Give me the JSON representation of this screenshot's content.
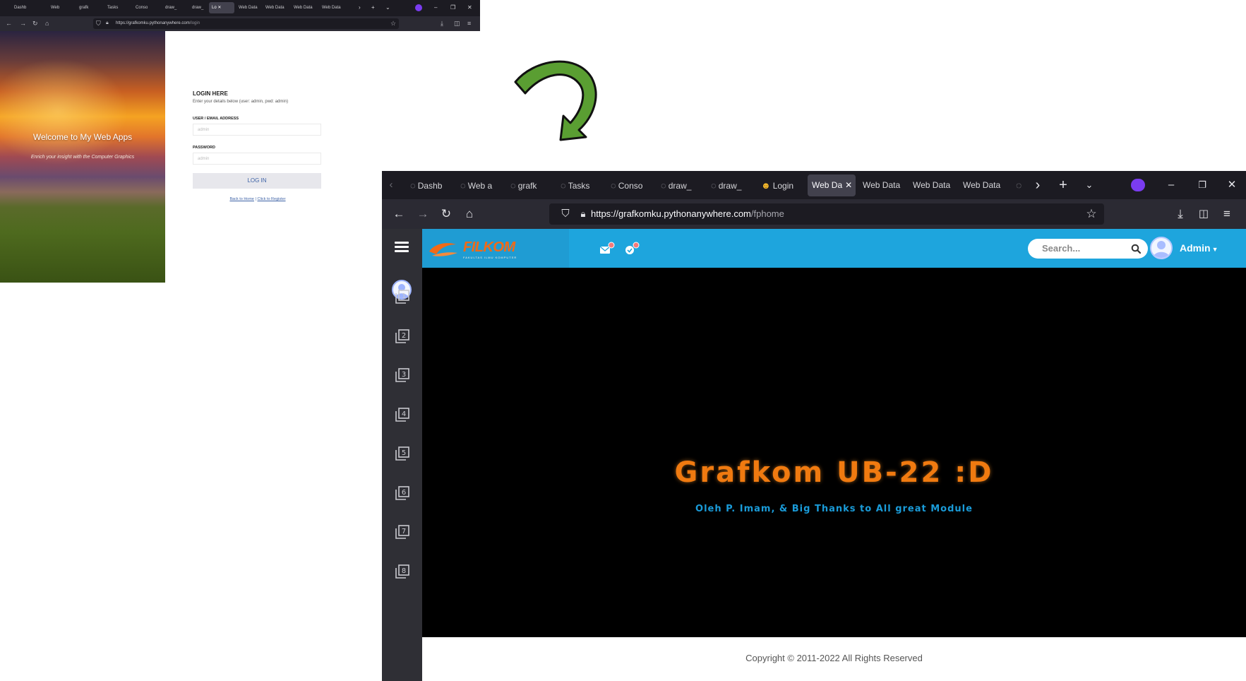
{
  "small_browser": {
    "tabs": [
      "Dashb",
      "Web",
      "grafk",
      "Tasks",
      "Conso",
      "draw_",
      "draw_",
      "Lo",
      "Web Data",
      "Web Data",
      "Web Data",
      "Web Data"
    ],
    "active_tab": "Lo",
    "url_host": "https://grafkomku.pythonanywhere.com",
    "url_path": "/login",
    "hero": {
      "title": "Welcome to My Web Apps",
      "subtitle": "Enrich your insight with the Computer Graphics"
    },
    "login": {
      "heading": "LOGIN HERE",
      "description": "Enter your details below (user: admin, pwd: admin)",
      "user_label": "USER / EMAIL ADDRESS",
      "user_placeholder": "admin",
      "password_label": "PASSWORD",
      "password_placeholder": "admin",
      "button": "LOG IN",
      "link_home": "Back to Home",
      "separator": "|",
      "link_register": "Click to Register"
    }
  },
  "big_browser": {
    "tabs": [
      "Dashb",
      "Web a",
      "grafk",
      "Tasks",
      "Conso",
      "draw_",
      "draw_",
      "Login",
      "Web Da",
      "Web Data",
      "Web Data",
      "Web Data"
    ],
    "active_tab": "Web Da",
    "url_host": "https://grafkomku.pythonanywhere.com",
    "url_path": "/fphome",
    "app": {
      "brand": "FILKOM",
      "brand_tagline": "FAKULTAS ILMU KOMPUTER",
      "search_placeholder": "Search...",
      "user_name": "Admin",
      "menu_numbers": [
        "1",
        "2",
        "3",
        "4",
        "5",
        "6",
        "7",
        "8"
      ],
      "main_title": "Grafkom UB-22 :D",
      "main_subtitle": "Oleh P. Imam, & Big Thanks to All great Module",
      "footer": "Copyright © 2011-2022 All Rights Reserved"
    }
  },
  "colors": {
    "header_blue": "#1ea5dd",
    "sidebar_dark": "#2f2f35",
    "title_orange": "#f07a10",
    "subtitle_blue": "#1a9bd8",
    "arrow_green": "#5a9e32"
  }
}
